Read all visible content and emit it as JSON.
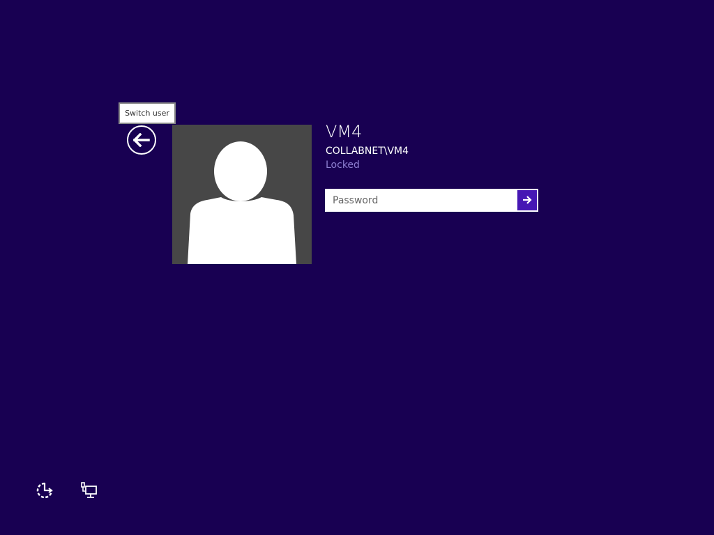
{
  "colors": {
    "background": "#180052",
    "avatar_bg": "#474747",
    "status_text": "#8d7fd1",
    "submit_button": "#4617b4"
  },
  "tooltip": {
    "text": "Switch user"
  },
  "back_button": {
    "icon": "arrow-left-circle-icon"
  },
  "user": {
    "name": "VM4",
    "domain": "COLLABNET\\VM4",
    "status": "Locked",
    "avatar_icon": "default-user-silhouette"
  },
  "password": {
    "placeholder": "Password",
    "value": "",
    "submit_icon": "arrow-right-icon"
  },
  "bottom_icons": {
    "ease_of_access": "ease-of-access-icon",
    "network": "network-icon"
  }
}
